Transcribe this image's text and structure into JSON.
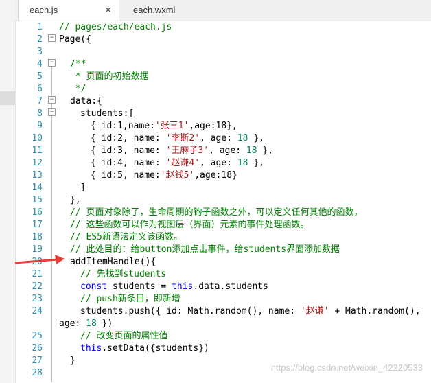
{
  "tabs": [
    {
      "label": "each.js",
      "close": "✕"
    },
    {
      "label": "each.wxml"
    }
  ],
  "code": {
    "line_numbers": [
      "1",
      "2",
      "3",
      "4",
      "5",
      "6",
      "7",
      "8",
      "9",
      "10",
      "11",
      "12",
      "13",
      "14",
      "15",
      "16",
      "17",
      "18",
      "19",
      "20",
      "21",
      "22",
      "23",
      "24",
      "25",
      "26",
      "27",
      "28"
    ],
    "l1": "// pages/each/each.js",
    "l2": "Page({",
    "l4": "/**",
    "l5": " * 页面的初始数据",
    "l6": " */",
    "l7": "data:{",
    "l8": "students:[",
    "l9_a": "{ id:1,name:",
    "l9_s": "'张三1'",
    "l9_b": ",age:18},",
    "l10_a": "{ id:2, name: ",
    "l10_s": "'李斯2'",
    "l10_b": ", age: ",
    "l10_n": "18",
    "l10_c": " },",
    "l11_a": "{ id:3, name: ",
    "l11_s": "'王麻子3'",
    "l11_b": ", age: ",
    "l11_n": "18",
    "l11_c": " },",
    "l12_a": "{ id:4, name: ",
    "l12_s": "'赵谦4'",
    "l12_b": ", age: ",
    "l12_n": "18",
    "l12_c": " },",
    "l13_a": "{ id:5, name:",
    "l13_s": "'赵钱5'",
    "l13_b": ",age:18}",
    "l14": "]",
    "l15": "},",
    "l16": "// 页面对象除了，生命周期的钩子函数之外，可以定义任何其他的函数，",
    "l17": "// 这些函数可以作为视图层（界面）元素的事件处理函数。",
    "l18": "// ES5新语法定义该函数。",
    "l19": "// 此处目的：给button添加点击事件，给students界面添加数据",
    "l20": "addItemHandle(){",
    "l21": "// 先找到students",
    "l22_kw": "const",
    "l22_a": " students = ",
    "l22_this": "this",
    "l22_b": ".data.students",
    "l23": "// push新条目，即新增",
    "l24_a": "students.push({ id: Math.random(), name: ",
    "l24_s": "'赵谦'",
    "l24_b": " + Math.random(),",
    "l24w_a": "age: ",
    "l24w_n": "18",
    "l24w_b": " })",
    "l25": "// 改变页面的属性值",
    "l26_this": "this",
    "l26_a": ".setData({students})",
    "l27": "}"
  },
  "watermark": "https://blog.csdn.net/weixin_42220533",
  "colors": {
    "comment": "#008000",
    "string": "#a31515",
    "keyword": "#0000ff",
    "number": "#098658",
    "line_number": "#2b91af",
    "arrow": "#e8413b"
  }
}
